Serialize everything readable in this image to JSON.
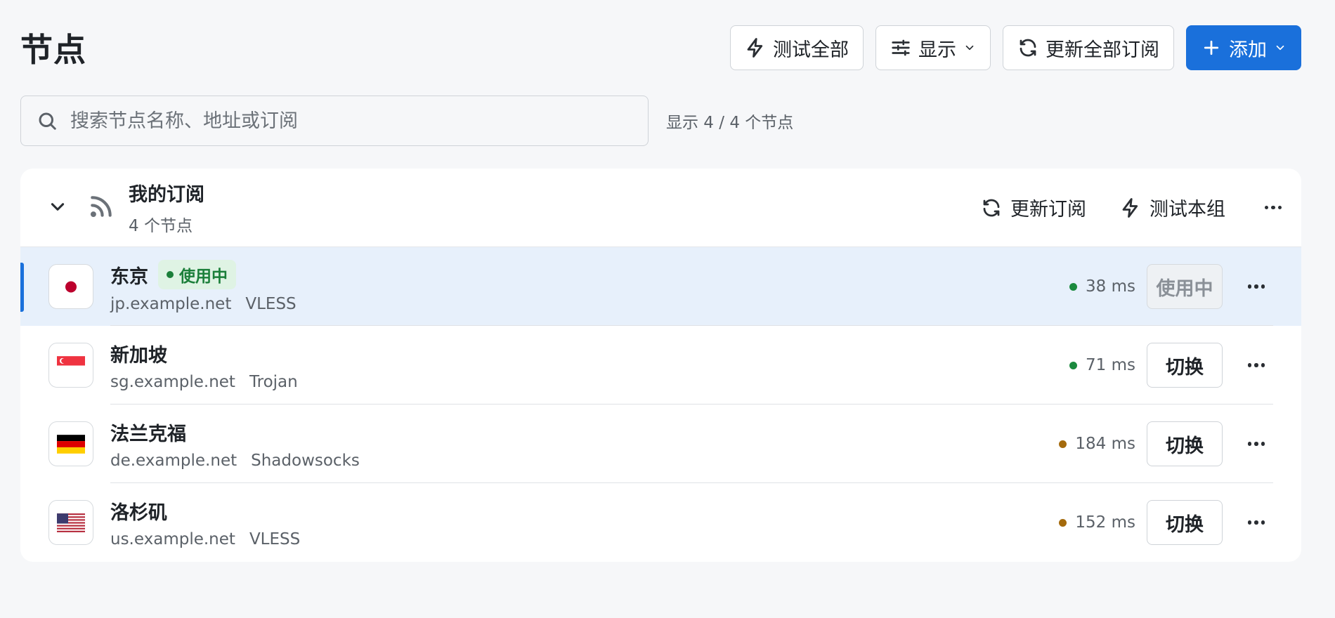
{
  "header": {
    "title": "节点",
    "test_all": "测试全部",
    "display": "显示",
    "update_all": "更新全部订阅",
    "add": "添加"
  },
  "search": {
    "placeholder": "搜索节点名称、地址或订阅",
    "count": "显示 4 / 4 个节点"
  },
  "group": {
    "title": "我的订阅",
    "subtitle": "4 个节点",
    "update": "更新订阅",
    "test": "测试本组"
  },
  "nodes": [
    {
      "name": "东京",
      "badge": "使用中",
      "host": "jp.example.net",
      "protocol": "VLESS",
      "latency": "38 ms",
      "latency_color": "#1b8a3e",
      "action": "使用中",
      "active": true,
      "flag": "jp"
    },
    {
      "name": "新加坡",
      "host": "sg.example.net",
      "protocol": "Trojan",
      "latency": "71 ms",
      "latency_color": "#1b8a3e",
      "action": "切换",
      "active": false,
      "flag": "sg"
    },
    {
      "name": "法兰克福",
      "host": "de.example.net",
      "protocol": "Shadowsocks",
      "latency": "184 ms",
      "latency_color": "#a46a0c",
      "action": "切换",
      "active": false,
      "flag": "de"
    },
    {
      "name": "洛杉矶",
      "host": "us.example.net",
      "protocol": "VLESS",
      "latency": "152 ms",
      "latency_color": "#a46a0c",
      "action": "切换",
      "active": false,
      "flag": "us"
    }
  ],
  "colors": {
    "accent": "#1a70db",
    "in_use": "#1b7f3a"
  }
}
